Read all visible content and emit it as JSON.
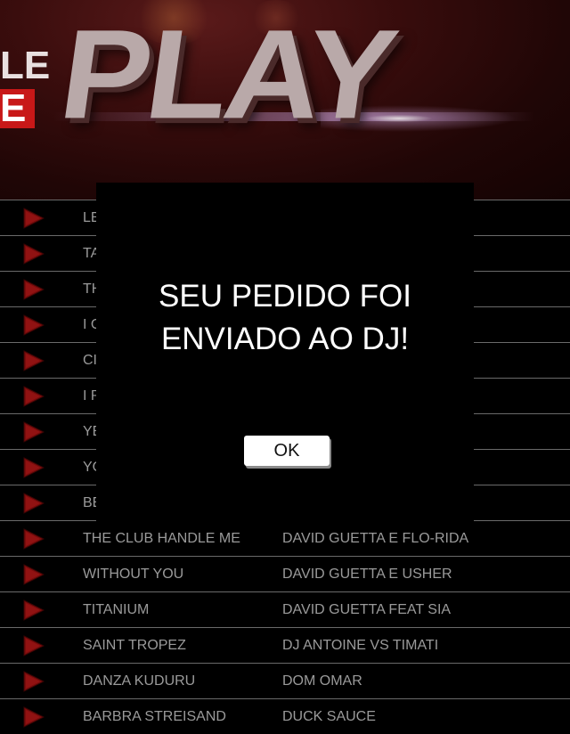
{
  "banner": {
    "logo_left_top": "LE",
    "logo_left_bottom": "E",
    "logo_main": "PLAY"
  },
  "songs": [
    {
      "title": "LE",
      "artist": ""
    },
    {
      "title": "TA",
      "artist": ""
    },
    {
      "title": "TH",
      "artist": ""
    },
    {
      "title": "I C",
      "artist": ""
    },
    {
      "title": "CI",
      "artist": ""
    },
    {
      "title": "I R",
      "artist": ""
    },
    {
      "title": "YE",
      "artist": ""
    },
    {
      "title": "YO",
      "artist": ""
    },
    {
      "title": "BE",
      "artist": ""
    },
    {
      "title": "THE CLUB HANDLE ME",
      "artist": "DAVID GUETTA E FLO-RIDA"
    },
    {
      "title": "WITHOUT YOU",
      "artist": "DAVID GUETTA E USHER"
    },
    {
      "title": "TITANIUM",
      "artist": "DAVID GUETTA FEAT SIA"
    },
    {
      "title": "SAINT TROPEZ",
      "artist": "DJ ANTOINE VS TIMATI"
    },
    {
      "title": "DANZA KUDURU",
      "artist": "DOM OMAR"
    },
    {
      "title": "BARBRA STREISAND",
      "artist": "DUCK SAUCE"
    }
  ],
  "dialog": {
    "message_line1": "SEU PEDIDO FOI",
    "message_line2": "ENVIADO AO DJ!",
    "ok_label": "OK"
  },
  "colors": {
    "accent": "#8a1010",
    "text_muted": "#9a9a9a",
    "divider": "#6a6a6a"
  }
}
